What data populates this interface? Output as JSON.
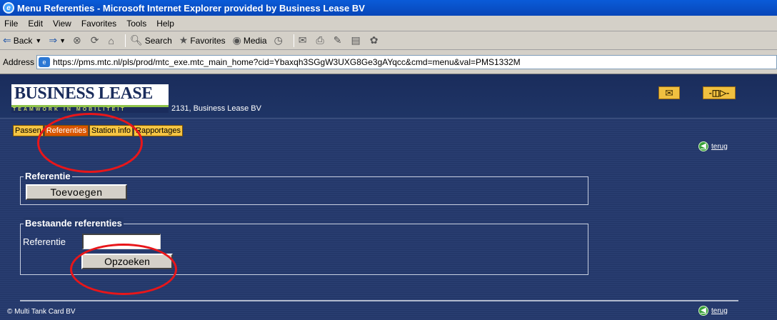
{
  "window": {
    "title": "Menu Referenties - Microsoft Internet Explorer provided by Business Lease BV",
    "ie_icon": "e"
  },
  "menubar": [
    "File",
    "Edit",
    "View",
    "Favorites",
    "Tools",
    "Help"
  ],
  "toolbar": {
    "back": "Back",
    "search": "Search",
    "favorites": "Favorites",
    "media": "Media"
  },
  "address": {
    "label": "Address",
    "url": "https://pms.mtc.nl/pls/prod/mtc_exe.mtc_main_home?cid=Ybaxqh3SGgW3UXG8Ge3gAYqcc&cmd=menu&val=PMS1332M"
  },
  "header": {
    "logo_text": "BUSINESS LEASE",
    "logo_tagline": "TEAMWORK IN MOBILITEIT",
    "company": "2131, Business Lease BV",
    "icons": [
      "mail-icon",
      "logout-plug-icon"
    ]
  },
  "tabs": [
    {
      "label": "Passen",
      "active": false
    },
    {
      "label": "Referenties",
      "active": true
    },
    {
      "label": "Station info",
      "active": false
    },
    {
      "label": "Rapportages",
      "active": false
    }
  ],
  "back_link": "terug",
  "referentie_group": {
    "title": "Referentie",
    "add_button": "Toevoegen"
  },
  "existing_group": {
    "title": "Bestaande referenties",
    "field_label": "Referentie",
    "field_value": "",
    "search_button": "Opzoeken"
  },
  "footer": "© Multi Tank Card BV",
  "colors": {
    "page_bg": "#24386a",
    "tab_bg": "#f5c543",
    "tab_active": "#d95500",
    "annotation": "#e8161a"
  }
}
